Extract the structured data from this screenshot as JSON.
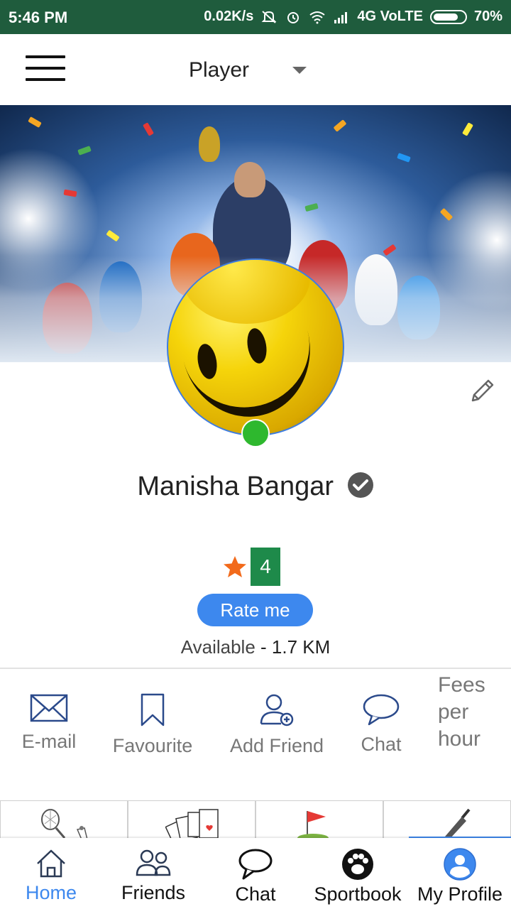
{
  "status_bar": {
    "time": "5:46 PM",
    "network_speed": "0.02K/s",
    "network_type": "4G VoLTE",
    "battery": "70%"
  },
  "app_bar": {
    "role_selected": "Player"
  },
  "profile": {
    "name": "Manisha Bangar",
    "rating_value": "4",
    "rate_button": "Rate me",
    "availability_label": "Available",
    "availability_separator": " - ",
    "distance": "1.7 KM",
    "online": true
  },
  "actions": [
    {
      "label": "E-mail",
      "icon": "mail-icon"
    },
    {
      "label": "Favourite",
      "icon": "bookmark-icon"
    },
    {
      "label": "Add Friend",
      "icon": "add-friend-icon"
    },
    {
      "label": "Chat",
      "icon": "chat-bubble-icon"
    }
  ],
  "fees": {
    "line1": "Fees",
    "line2": "per",
    "line3": "hour"
  },
  "sport_tiles": [
    {
      "icon": "badminton-icon"
    },
    {
      "icon": "playing-cards-icon"
    },
    {
      "icon": "golf-flag-icon"
    },
    {
      "icon": "cricket-bat-icon",
      "selected": true
    }
  ],
  "bottom_nav": [
    {
      "label": "Home",
      "icon": "home-icon",
      "active": true
    },
    {
      "label": "Friends",
      "icon": "friends-icon"
    },
    {
      "label": "Chat",
      "icon": "chat-icon"
    },
    {
      "label": "Sportbook",
      "icon": "paw-icon"
    },
    {
      "label": "My Profile",
      "icon": "profile-icon"
    }
  ],
  "colors": {
    "status_bar": "#1f5c3d",
    "accent": "#3d88ee",
    "rating_badge": "#1e8a4a",
    "online": "#2eb82e",
    "star": "#f26a1b"
  }
}
